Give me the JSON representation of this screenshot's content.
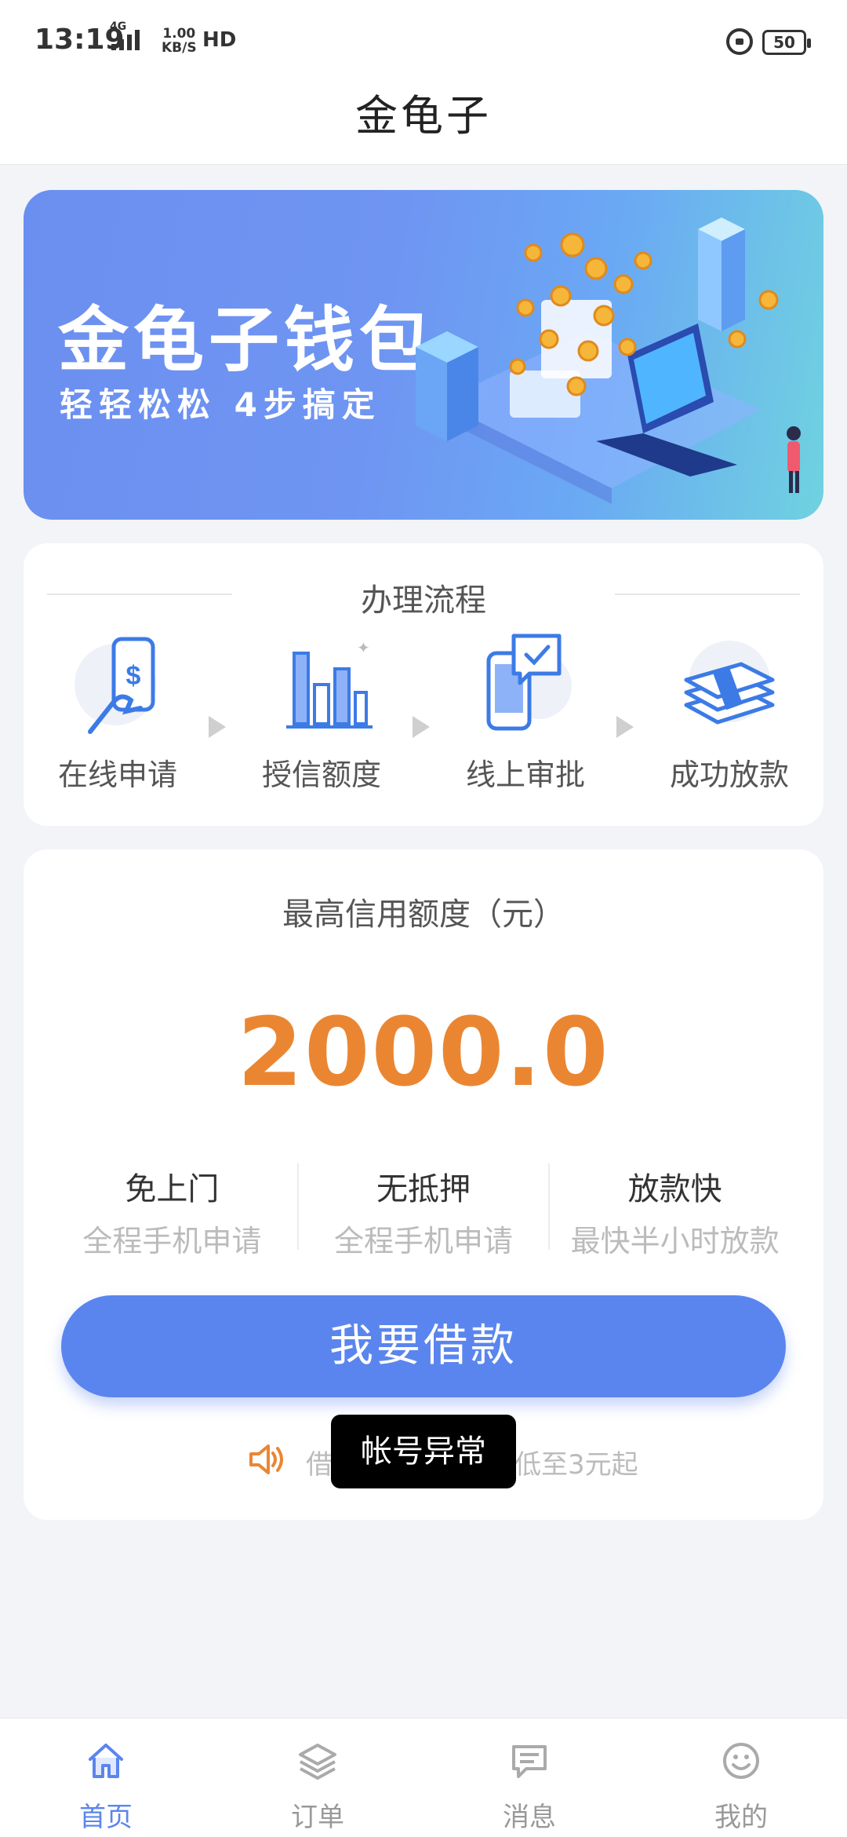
{
  "status_bar": {
    "time": "13:19",
    "network": "4G",
    "speed_value": "1.00",
    "speed_unit": "KB/S",
    "hd": "HD",
    "battery": "50"
  },
  "app_bar": {
    "title": "金龟子"
  },
  "banner": {
    "title": "金龟子钱包",
    "subtitle": "轻轻松松 4步搞定"
  },
  "process": {
    "title": "办理流程",
    "steps": [
      {
        "label": "在线申请",
        "icon": "hand-phone-dollar-icon"
      },
      {
        "label": "授信额度",
        "icon": "bar-chart-icon"
      },
      {
        "label": "线上审批",
        "icon": "phone-check-icon"
      },
      {
        "label": "成功放款",
        "icon": "cash-stack-icon"
      }
    ]
  },
  "credit": {
    "label": "最高信用额度（元）",
    "amount": "2000.0",
    "features": [
      {
        "title": "免上门",
        "desc": "全程手机申请"
      },
      {
        "title": "无抵押",
        "desc": "全程手机申请"
      },
      {
        "title": "放款快",
        "desc": "最快半小时放款"
      }
    ],
    "button_label": "我要借款",
    "notice_prefix": "借",
    "notice_suffix": "低至3元起",
    "notice_icon": "speaker-icon"
  },
  "toast": {
    "text": "帐号异常"
  },
  "bottom_nav": {
    "items": [
      {
        "label": "首页",
        "icon": "home-icon",
        "active": true
      },
      {
        "label": "订单",
        "icon": "layers-icon",
        "active": false
      },
      {
        "label": "消息",
        "icon": "message-icon",
        "active": false
      },
      {
        "label": "我的",
        "icon": "smile-icon",
        "active": false
      }
    ]
  },
  "colors": {
    "accent": "#5b85ee",
    "amount": "#ea8632",
    "background": "#f2f4f8"
  }
}
